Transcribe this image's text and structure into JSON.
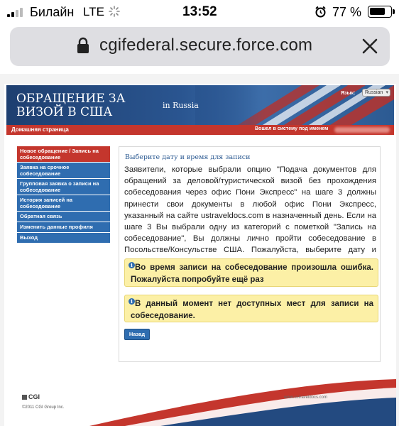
{
  "status_bar": {
    "carrier": "Билайн",
    "network": "LTE",
    "time": "13:52",
    "battery": "77 %",
    "battery_level": 0.77
  },
  "browser": {
    "url": "cgifederal.secure.force.com"
  },
  "header": {
    "title": "ОБРАЩЕНИЕ ЗА ВИЗОЙ В США",
    "country": "in Russia",
    "language_label": "Язык:",
    "language_value": "Russian",
    "home_link": "Домашняя страница",
    "logged_in": "Вошел в систему под именем"
  },
  "menu": {
    "items": [
      {
        "label": "Новое обращение / Запись на собеседование",
        "active": true
      },
      {
        "label": "Заявка на срочное собеседование",
        "active": false
      },
      {
        "label": "Групповая заявка о записи на собеседование",
        "active": false
      },
      {
        "label": "История записей на собеседование",
        "active": false
      },
      {
        "label": "Обратная связь",
        "active": false
      },
      {
        "label": "Изменить данные профиля",
        "active": false
      },
      {
        "label": "Выход",
        "active": false
      }
    ]
  },
  "content": {
    "title": "Выберите дату и время для записи",
    "text": "Заявители, которые выбрали опцию \"Подача документов для обращений за деловой/туристической визой без прохождения собеседования через офис Пони Экспресс\" на шаге 3 должны принести свои документы в любой офис Пони Экспресс, указанный на сайте ustraveldocs.com в назначенный день. Если на шаге 3 Вы выбрали одну из категорий с пометкой \"Запись на собеседование\", Вы должны лично пройти собеседование в Посольстве/Консульстве США. Пожалуйста, выберите дату и время.",
    "alert1": "Во время записи на собеседование произошла ошибка. Пожалуйста попробуйте ещё раз",
    "alert2": "В данный момент нет доступных мест для записи на собеседование.",
    "back_button": "Назад"
  },
  "footer": {
    "logo": "CGI",
    "copyright": "©2011 CGI Group Inc.",
    "url": "www.ustraveldocs.com"
  },
  "colors": {
    "header_blue": "#2a5590",
    "nav_red": "#c4362d",
    "menu_blue": "#2f6db0",
    "alert_yellow": "#fcf0a6"
  }
}
